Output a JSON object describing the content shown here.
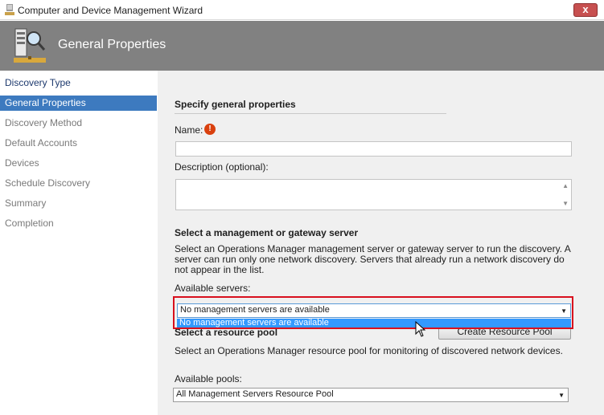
{
  "window": {
    "title": "Computer and Device Management Wizard",
    "close_label": "x"
  },
  "banner": {
    "title": "General Properties"
  },
  "nav": {
    "items": [
      {
        "label": "Discovery Type",
        "state": "done"
      },
      {
        "label": "General Properties",
        "state": "active"
      },
      {
        "label": "Discovery Method",
        "state": "pending"
      },
      {
        "label": "Default Accounts",
        "state": "pending"
      },
      {
        "label": "Devices",
        "state": "pending"
      },
      {
        "label": "Schedule Discovery",
        "state": "pending"
      },
      {
        "label": "Summary",
        "state": "pending"
      },
      {
        "label": "Completion",
        "state": "pending"
      }
    ]
  },
  "general": {
    "heading": "Specify general properties",
    "name_label": "Name:",
    "name_value": "",
    "required_icon": "!",
    "description_label": "Description (optional):",
    "description_value": ""
  },
  "server": {
    "heading": "Select a management or gateway server",
    "description": "Select an Operations Manager management server or gateway server to run the discovery. A server can run only one network discovery. Servers that already run a network discovery do not appear in the list.",
    "available_label": "Available servers:",
    "selected_value": "No management servers are available",
    "dropdown_option": "No management servers are available"
  },
  "pool": {
    "heading": "Select a resource pool",
    "create_button": "Create Resource Pool",
    "description": "Select an Operations Manager resource pool for monitoring of discovered network devices.",
    "available_label": "Available pools:",
    "selected_value": "All Management Servers Resource Pool"
  },
  "colors": {
    "banner": "#818181",
    "nav_active": "#3d7abf",
    "highlight": "#d8101e",
    "dropdown_selection": "#3399ff"
  }
}
